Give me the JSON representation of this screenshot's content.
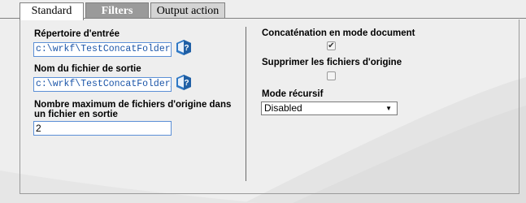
{
  "tabs": [
    {
      "label": "Standard",
      "active": true
    },
    {
      "label": "Filters",
      "active": false
    },
    {
      "label": "Output action",
      "active": false
    }
  ],
  "left": {
    "input_dir": {
      "label": "Répertoire d'entrée",
      "value": "c:\\wrkf\\TestConcatFolder",
      "icon": "book-help-icon"
    },
    "output_file": {
      "label": "Nom du fichier de sortie",
      "value": "c:\\wrkf\\TestConcatFolder_S\\f",
      "icon": "book-help-icon"
    },
    "max_files": {
      "label_line1": "Nombre maximum de fichiers d'origine dans",
      "label_line2": "un fichier en sortie",
      "value": "2"
    }
  },
  "right": {
    "concat_doc": {
      "label": "Concaténation en mode document",
      "checked": true
    },
    "delete_src": {
      "label": "Supprimer les fichiers d'origine",
      "checked": false
    },
    "recursive": {
      "label": "Mode récursif",
      "selected": "Disabled"
    }
  },
  "colors": {
    "accent_text": "#1b55a8",
    "field_border": "#5b8fd6",
    "inactive_tab": "#9a9a9a"
  }
}
